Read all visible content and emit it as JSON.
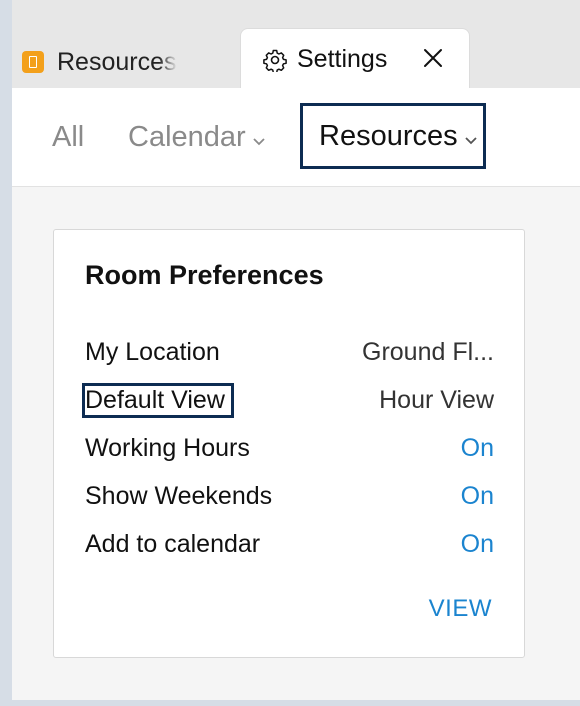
{
  "tabs": [
    {
      "label": "Resources",
      "icon": "resource-icon",
      "active": false
    },
    {
      "label": "Settings",
      "icon": "gear-icon",
      "active": true,
      "close_icon": "close-icon"
    }
  ],
  "nav": {
    "items": [
      {
        "label": "All",
        "has_dropdown": false
      },
      {
        "label": "Calendar",
        "has_dropdown": true
      },
      {
        "label": "Resources",
        "has_dropdown": true,
        "selected": true
      }
    ]
  },
  "card": {
    "title": "Room Preferences",
    "rows": [
      {
        "label": "My Location",
        "value": "Ground Fl..."
      },
      {
        "label": "Default View",
        "value": "Hour View"
      },
      {
        "label": "Working Hours",
        "value": "On"
      },
      {
        "label": "Show Weekends",
        "value": "On"
      },
      {
        "label": "Add to calendar",
        "value": "On"
      }
    ],
    "view_link": "VIEW"
  },
  "colors": {
    "accent": "#1b84cf",
    "highlight_border": "#0d2c52",
    "resource_icon": "#f3a01b"
  }
}
